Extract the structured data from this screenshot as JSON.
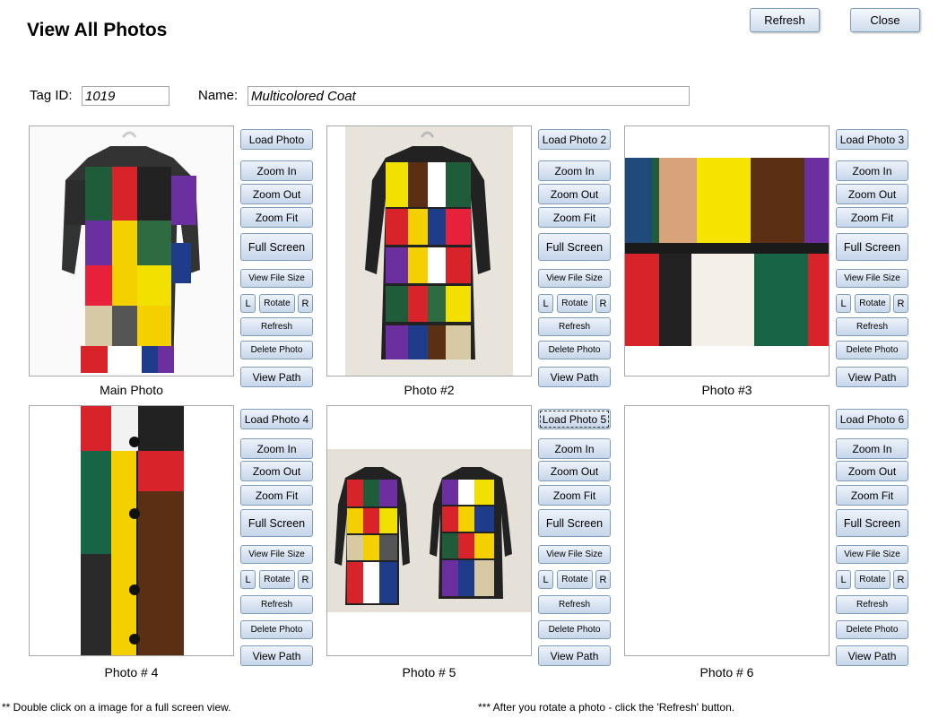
{
  "page_title": "View All Photos",
  "buttons": {
    "refresh": "Refresh",
    "close": "Close"
  },
  "form": {
    "tag_label": "Tag ID:",
    "tag_value": "1019",
    "name_label": "Name:",
    "name_value": "Multicolored Coat"
  },
  "photos": [
    {
      "caption": "Main Photo",
      "load": "Load Photo",
      "image": "coat-front-image"
    },
    {
      "caption": "Photo #2",
      "load": "Load Photo 2",
      "image": "coat-back-image"
    },
    {
      "caption": "Photo #3",
      "load": "Load Photo 3",
      "image": "fabric-detail-image"
    },
    {
      "caption": "Photo # 4",
      "load": "Load Photo 4",
      "image": "coat-button-closeup-image"
    },
    {
      "caption": "Photo # 5",
      "load": "Load Photo 5",
      "image": "two-coats-image"
    },
    {
      "caption": "Photo # 6",
      "load": "Load Photo 6",
      "image": ""
    }
  ],
  "controls": {
    "zoom_in": "Zoom In",
    "zoom_out": "Zoom Out",
    "zoom_fit": "Zoom Fit",
    "full_screen": "Full Screen",
    "view_file_size": "View File Size",
    "rotate_left": "L",
    "rotate": "Rotate",
    "rotate_right": "R",
    "refresh": "Refresh",
    "delete_photo": "Delete Photo",
    "view_path": "View Path"
  },
  "notes": {
    "double_click": "** Double click on a image for a full screen view.",
    "rotate": "*** After you rotate a photo - click the 'Refresh' button."
  },
  "colors": {
    "button_border": "#7f9db9",
    "button_fill": "#cfdcec"
  }
}
